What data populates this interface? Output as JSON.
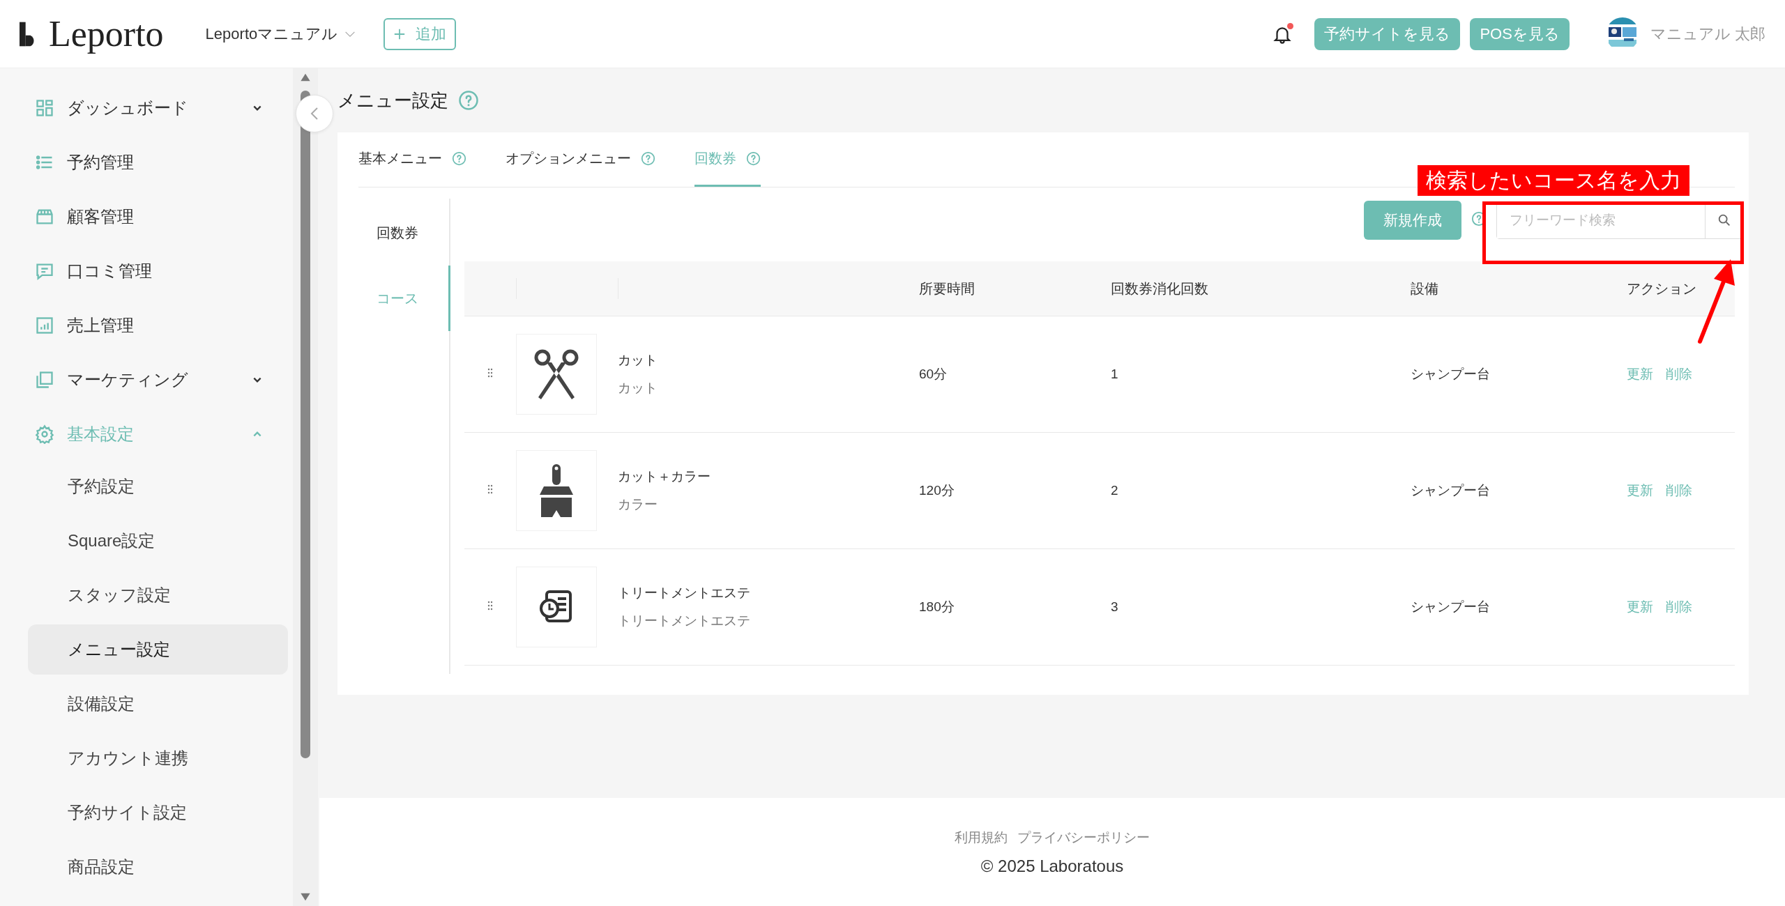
{
  "header": {
    "logo": "Leporto",
    "store_selector": "Leportoマニュアル",
    "add_button": "追加",
    "notification": {
      "unread": true
    },
    "buttons": [
      "予約サイトを見る",
      "POSを見る"
    ],
    "user_name": "マニュアル 太郎"
  },
  "sidebar": {
    "items": [
      {
        "label": "ダッシュボード",
        "kind": "menu",
        "expanded": false,
        "selected": false
      },
      {
        "label": "予約管理",
        "kind": "link",
        "selected": false
      },
      {
        "label": "顧客管理",
        "kind": "link",
        "selected": false
      },
      {
        "label": "口コミ管理",
        "kind": "link",
        "selected": false
      },
      {
        "label": "売上管理",
        "kind": "link",
        "selected": false
      },
      {
        "label": "マーケティング",
        "kind": "menu",
        "expanded": false,
        "selected": false
      },
      {
        "label": "基本設定",
        "kind": "menu",
        "expanded": true,
        "selected": false,
        "children": [
          {
            "label": "予約設定",
            "selected": false
          },
          {
            "label": "Square設定",
            "selected": false
          },
          {
            "label": "スタッフ設定",
            "selected": false
          },
          {
            "label": "メニュー設定",
            "selected": true
          },
          {
            "label": "設備設定",
            "selected": false
          },
          {
            "label": "アカウント連携",
            "selected": false
          },
          {
            "label": "予約サイト設定",
            "selected": false
          },
          {
            "label": "商品設定",
            "selected": false
          }
        ]
      }
    ]
  },
  "page": {
    "title": "メニュー設定",
    "tabs": [
      {
        "label": "基本メニュー",
        "selected": false
      },
      {
        "label": "オプションメニュー",
        "selected": false
      },
      {
        "label": "回数券",
        "selected": true
      }
    ],
    "subnav": [
      {
        "label": "回数券",
        "selected": false
      },
      {
        "label": "コース",
        "selected": true
      }
    ],
    "create_button": "新規作成",
    "search": {
      "placeholder": "フリーワード検索"
    },
    "table": {
      "columns": [
        "所要時間",
        "回数券消化回数",
        "設備",
        "アクション"
      ],
      "rows": [
        {
          "name": "カット",
          "category": "カット",
          "duration": "60分",
          "count": "1",
          "equipment": "シャンプー台",
          "actions": [
            "更新",
            "削除"
          ]
        },
        {
          "name": "カット＋カラー",
          "category": "カラー",
          "duration": "120分",
          "count": "2",
          "equipment": "シャンプー台",
          "actions": [
            "更新",
            "削除"
          ]
        },
        {
          "name": "トリートメントエステ",
          "category": "トリートメントエステ",
          "duration": "180分",
          "count": "3",
          "equipment": "シャンプー台",
          "actions": [
            "更新",
            "削除"
          ]
        }
      ]
    }
  },
  "annotation": {
    "label": "検索したいコース名を入力"
  },
  "footer": {
    "links": [
      "利用規約",
      "プライバシーポリシー"
    ],
    "copyright": "© 2025 Laboratous"
  }
}
